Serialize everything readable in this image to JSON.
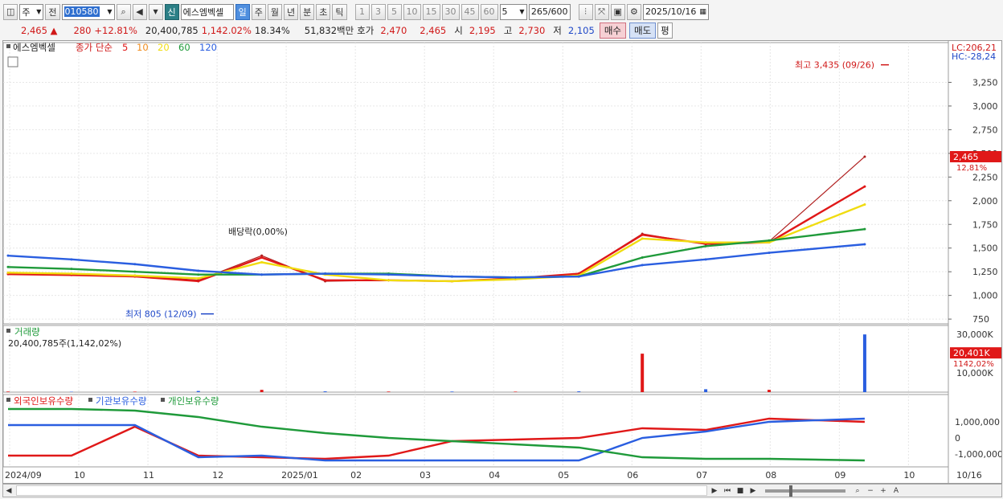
{
  "toolbar": {
    "market": "주",
    "prev": "전",
    "code": "010580",
    "sin_label": "신",
    "stock_name": "에스엠벡셀",
    "periods": [
      "일",
      "주",
      "월",
      "년",
      "분",
      "초",
      "틱"
    ],
    "active_period": "일",
    "intervals": [
      "1",
      "3",
      "5",
      "10",
      "15",
      "30",
      "45",
      "60"
    ],
    "interval_value": "5",
    "count": "265",
    "count_max": "/600",
    "date": "2025/10/16"
  },
  "quote": {
    "price": "2,465",
    "change_arrow": "▲",
    "change": "280",
    "change_pct": "+12.81%",
    "volume": "20,400,785",
    "volume_ratio": "1,142.02%",
    "turnover": "18.34%",
    "amount": "51,832백만",
    "bid_label": "호가",
    "ask": "2,470",
    "bid": "2,465",
    "open_label": "시",
    "open": "2,195",
    "high_label": "고",
    "high": "2,730",
    "low_label": "저",
    "low": "2,105",
    "buy_btn": "매수",
    "sell_btn": "매도",
    "eval_btn": "평"
  },
  "legend": {
    "stock": "에스엠벡셀",
    "ma_label": "종가 단순",
    "ma_periods": [
      {
        "p": "5",
        "color": "#e01818"
      },
      {
        "p": "10",
        "color": "#f08c1c"
      },
      {
        "p": "20",
        "color": "#f0dc10"
      },
      {
        "p": "60",
        "color": "#1f9a3a"
      },
      {
        "p": "120",
        "color": "#2a5ee0"
      }
    ]
  },
  "annotations": {
    "high": "최고 3,435 (09/26)",
    "low": "최저 805 (12/09)",
    "dividend": "배당락(0,00%)"
  },
  "price_axis": {
    "ticks": [
      "3,250",
      "3,000",
      "2,750",
      "2,500",
      "2,250",
      "2,000",
      "1,750",
      "1,500",
      "1,250",
      "1,000",
      "750"
    ],
    "lc": "LC:206,21",
    "hc": "HC:-28,24",
    "current": "2,465",
    "current_pct": "12,81%"
  },
  "volume_panel": {
    "title": "거래량",
    "value": "20,400,785주(1,142,02%)",
    "ticks": [
      "30,000K",
      "20,000K",
      "10,000K"
    ],
    "current": "20,401K",
    "current_pct": "1142,02%"
  },
  "holding_panel": {
    "legend": [
      "외국인보유수량",
      "기관보유수량",
      "개인보유수량"
    ],
    "colors": [
      "#e01818",
      "#2a5ee0",
      "#1f9a3a"
    ],
    "ticks": [
      "1,000,000",
      "0",
      "-1,000,000"
    ]
  },
  "xaxis": {
    "labels": [
      "2024/09",
      "10",
      "11",
      "12",
      "2025/01",
      "02",
      "03",
      "04",
      "05",
      "06",
      "07",
      "08",
      "09",
      "10"
    ],
    "date_end": "10/16"
  },
  "chart_data": {
    "type": "line",
    "title": "",
    "x": [
      "2024/09",
      "10",
      "11",
      "12",
      "2025/01",
      "02",
      "03",
      "04",
      "05",
      "06",
      "07",
      "08",
      "09",
      "10"
    ],
    "price_range": [
      700,
      3500
    ],
    "series": [
      {
        "name": "종가",
        "values": [
          1230,
          1220,
          1210,
          1160,
          1420,
          1150,
          1160,
          1150,
          1180,
          1230,
          1650,
          1540,
          1570,
          2465
        ]
      },
      {
        "name": "5",
        "values": [
          1225,
          1215,
          1200,
          1150,
          1400,
          1160,
          1160,
          1150,
          1180,
          1230,
          1640,
          1545,
          1560,
          2150
        ]
      },
      {
        "name": "20",
        "values": [
          1240,
          1230,
          1210,
          1180,
          1350,
          1220,
          1160,
          1150,
          1170,
          1210,
          1600,
          1560,
          1560,
          1960
        ]
      },
      {
        "name": "60",
        "values": [
          1300,
          1280,
          1250,
          1220,
          1220,
          1230,
          1230,
          1200,
          1190,
          1200,
          1400,
          1520,
          1580,
          1700
        ]
      },
      {
        "name": "120",
        "values": [
          1420,
          1380,
          1330,
          1260,
          1220,
          1230,
          1220,
          1200,
          1190,
          1200,
          1320,
          1380,
          1450,
          1540
        ]
      }
    ],
    "volume_k": [
      300,
      200,
      250,
      600,
      1200,
      400,
      300,
      300,
      250,
      400,
      20000,
      1500,
      1200,
      30000
    ],
    "holdings": [
      {
        "name": "외국인보유수량",
        "values": [
          -1100000,
          -1100000,
          700000,
          -1100000,
          -1200000,
          -1300000,
          -1100000,
          -200000,
          -100000,
          0,
          600000,
          500000,
          1200000,
          1000000
        ]
      },
      {
        "name": "기관보유수량",
        "values": [
          800000,
          800000,
          800000,
          -1200000,
          -1100000,
          -1400000,
          -1400000,
          -1400000,
          -1400000,
          -1400000,
          0,
          400000,
          1000000,
          1200000
        ]
      },
      {
        "name": "개인보유수량",
        "values": [
          1800000,
          1800000,
          1700000,
          1300000,
          700000,
          300000,
          0,
          -200000,
          -400000,
          -600000,
          -1200000,
          -1300000,
          -1300000,
          -1400000
        ]
      }
    ]
  }
}
